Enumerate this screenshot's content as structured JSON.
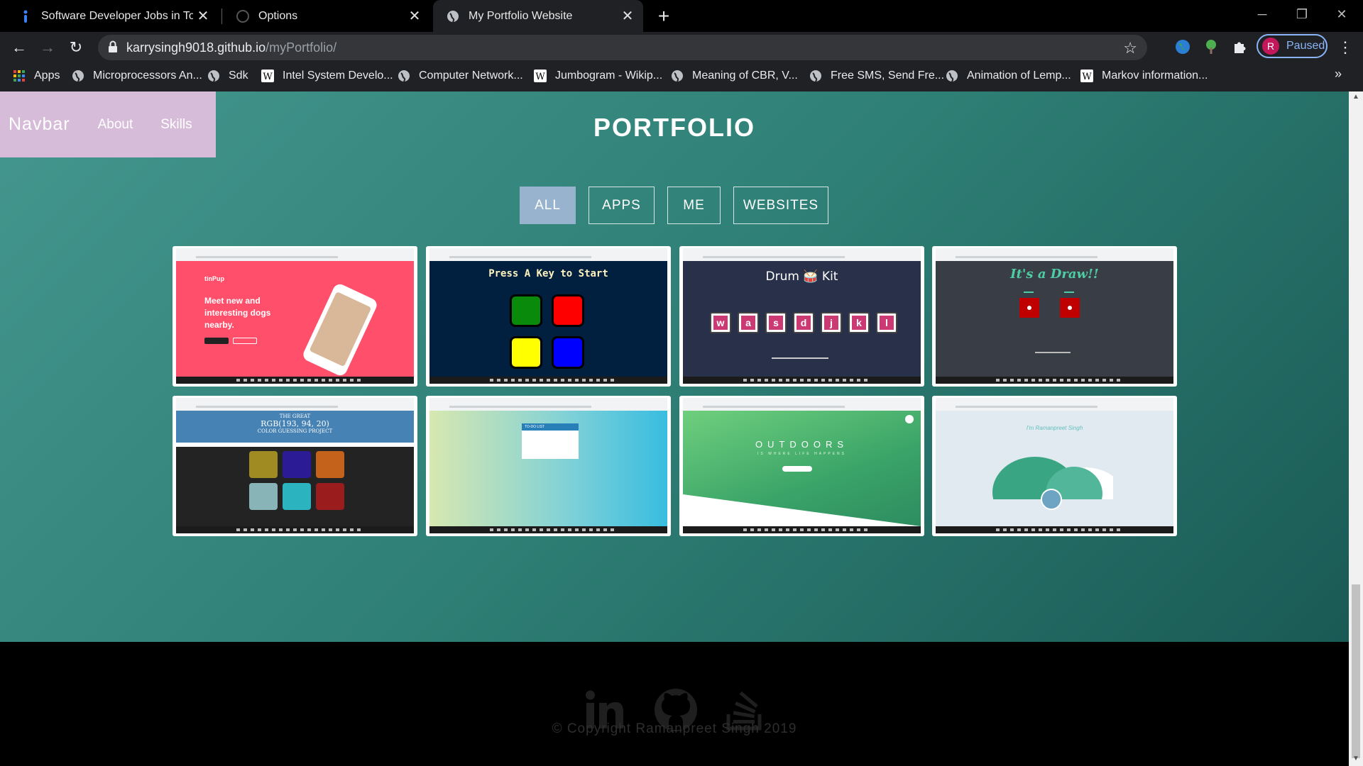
{
  "browser": {
    "tabs": [
      {
        "title": "Software Developer Jobs in Toronto",
        "icon": "indeed-icon",
        "active": false
      },
      {
        "title": "Options",
        "icon": "github-icon",
        "active": false
      },
      {
        "title": "My Portfolio Website",
        "icon": "globe-icon",
        "active": true
      }
    ],
    "url_host": "karrysingh9018.github.io",
    "url_path": "/myPortfolio/",
    "profile_initial": "R",
    "profile_status": "Paused",
    "bookmarks": [
      {
        "label": "Apps",
        "icon": "apps-grid-icon"
      },
      {
        "label": "Microprocessors An...",
        "icon": "globe-icon"
      },
      {
        "label": "Sdk",
        "icon": "globe-icon"
      },
      {
        "label": "Intel System Develo...",
        "icon": "wikipedia-icon"
      },
      {
        "label": "Computer Network...",
        "icon": "globe-icon"
      },
      {
        "label": "Jumbogram - Wikip...",
        "icon": "wikipedia-icon"
      },
      {
        "label": "Meaning of CBR, V...",
        "icon": "globe-icon"
      },
      {
        "label": "Free SMS, Send Fre...",
        "icon": "globe-icon"
      },
      {
        "label": "Animation of Lemp...",
        "icon": "globe-icon"
      },
      {
        "label": "Markov information...",
        "icon": "wikipedia-icon"
      }
    ],
    "bookmarks_more": "»"
  },
  "navbar": {
    "brand": "Navbar",
    "links": [
      "About",
      "Skills"
    ]
  },
  "portfolio": {
    "title": "PORTFOLIO",
    "filters": [
      "ALL",
      "APPS",
      "ME",
      "WEBSITES"
    ],
    "active_filter": "ALL",
    "projects": [
      {
        "kind": "tinpup",
        "brand": "tinPup",
        "headline": "Meet new and interesting dogs nearby."
      },
      {
        "kind": "simon",
        "headline": "Press A Key to Start"
      },
      {
        "kind": "drum",
        "headline": "Drum 🥁 Kit",
        "keys": [
          "w",
          "a",
          "s",
          "d",
          "j",
          "k",
          "l"
        ]
      },
      {
        "kind": "dice",
        "headline": "It's a Draw!!"
      },
      {
        "kind": "rgb",
        "line1": "THE GREAT",
        "headline": "RGB(193, 94, 20)",
        "line3": "COLOR GUESSING PROJECT"
      },
      {
        "kind": "todo",
        "headline": "TO-DO LIST"
      },
      {
        "kind": "outdoors",
        "headline": "OUTDOORS",
        "subline": "IS WHERE LIFE HAPPENS"
      },
      {
        "kind": "personal",
        "headline": "I'm Ramanpreet Singh"
      }
    ]
  },
  "footer": {
    "icons": [
      "linkedin-icon",
      "github-icon",
      "stackoverflow-icon"
    ],
    "copyright": "© Copyright Ramanpreet Singh 2019"
  },
  "colors": {
    "accent_filter": "#97b3cd",
    "navbar_bg": "#d7bcd9",
    "hero_gradient": [
      "#44978e",
      "#1a5a55"
    ]
  }
}
